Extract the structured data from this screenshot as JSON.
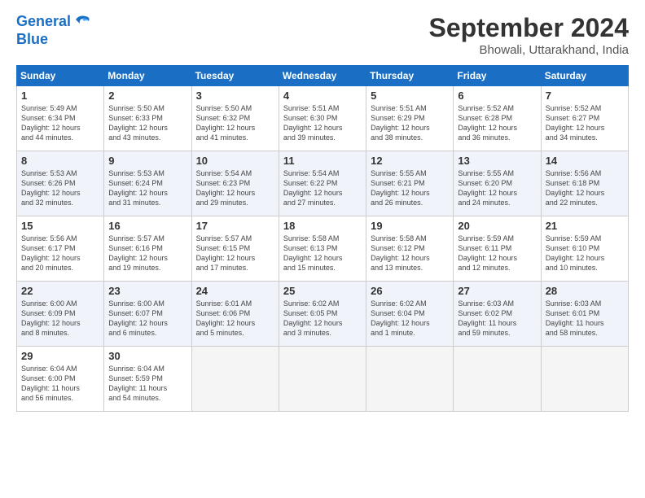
{
  "header": {
    "logo_line1": "General",
    "logo_line2": "Blue",
    "month": "September 2024",
    "location": "Bhowali, Uttarakhand, India"
  },
  "weekdays": [
    "Sunday",
    "Monday",
    "Tuesday",
    "Wednesday",
    "Thursday",
    "Friday",
    "Saturday"
  ],
  "weeks": [
    [
      {
        "day": "1",
        "info": "Sunrise: 5:49 AM\nSunset: 6:34 PM\nDaylight: 12 hours\nand 44 minutes."
      },
      {
        "day": "2",
        "info": "Sunrise: 5:50 AM\nSunset: 6:33 PM\nDaylight: 12 hours\nand 43 minutes."
      },
      {
        "day": "3",
        "info": "Sunrise: 5:50 AM\nSunset: 6:32 PM\nDaylight: 12 hours\nand 41 minutes."
      },
      {
        "day": "4",
        "info": "Sunrise: 5:51 AM\nSunset: 6:30 PM\nDaylight: 12 hours\nand 39 minutes."
      },
      {
        "day": "5",
        "info": "Sunrise: 5:51 AM\nSunset: 6:29 PM\nDaylight: 12 hours\nand 38 minutes."
      },
      {
        "day": "6",
        "info": "Sunrise: 5:52 AM\nSunset: 6:28 PM\nDaylight: 12 hours\nand 36 minutes."
      },
      {
        "day": "7",
        "info": "Sunrise: 5:52 AM\nSunset: 6:27 PM\nDaylight: 12 hours\nand 34 minutes."
      }
    ],
    [
      {
        "day": "8",
        "info": "Sunrise: 5:53 AM\nSunset: 6:26 PM\nDaylight: 12 hours\nand 32 minutes."
      },
      {
        "day": "9",
        "info": "Sunrise: 5:53 AM\nSunset: 6:24 PM\nDaylight: 12 hours\nand 31 minutes."
      },
      {
        "day": "10",
        "info": "Sunrise: 5:54 AM\nSunset: 6:23 PM\nDaylight: 12 hours\nand 29 minutes."
      },
      {
        "day": "11",
        "info": "Sunrise: 5:54 AM\nSunset: 6:22 PM\nDaylight: 12 hours\nand 27 minutes."
      },
      {
        "day": "12",
        "info": "Sunrise: 5:55 AM\nSunset: 6:21 PM\nDaylight: 12 hours\nand 26 minutes."
      },
      {
        "day": "13",
        "info": "Sunrise: 5:55 AM\nSunset: 6:20 PM\nDaylight: 12 hours\nand 24 minutes."
      },
      {
        "day": "14",
        "info": "Sunrise: 5:56 AM\nSunset: 6:18 PM\nDaylight: 12 hours\nand 22 minutes."
      }
    ],
    [
      {
        "day": "15",
        "info": "Sunrise: 5:56 AM\nSunset: 6:17 PM\nDaylight: 12 hours\nand 20 minutes."
      },
      {
        "day": "16",
        "info": "Sunrise: 5:57 AM\nSunset: 6:16 PM\nDaylight: 12 hours\nand 19 minutes."
      },
      {
        "day": "17",
        "info": "Sunrise: 5:57 AM\nSunset: 6:15 PM\nDaylight: 12 hours\nand 17 minutes."
      },
      {
        "day": "18",
        "info": "Sunrise: 5:58 AM\nSunset: 6:13 PM\nDaylight: 12 hours\nand 15 minutes."
      },
      {
        "day": "19",
        "info": "Sunrise: 5:58 AM\nSunset: 6:12 PM\nDaylight: 12 hours\nand 13 minutes."
      },
      {
        "day": "20",
        "info": "Sunrise: 5:59 AM\nSunset: 6:11 PM\nDaylight: 12 hours\nand 12 minutes."
      },
      {
        "day": "21",
        "info": "Sunrise: 5:59 AM\nSunset: 6:10 PM\nDaylight: 12 hours\nand 10 minutes."
      }
    ],
    [
      {
        "day": "22",
        "info": "Sunrise: 6:00 AM\nSunset: 6:09 PM\nDaylight: 12 hours\nand 8 minutes."
      },
      {
        "day": "23",
        "info": "Sunrise: 6:00 AM\nSunset: 6:07 PM\nDaylight: 12 hours\nand 6 minutes."
      },
      {
        "day": "24",
        "info": "Sunrise: 6:01 AM\nSunset: 6:06 PM\nDaylight: 12 hours\nand 5 minutes."
      },
      {
        "day": "25",
        "info": "Sunrise: 6:02 AM\nSunset: 6:05 PM\nDaylight: 12 hours\nand 3 minutes."
      },
      {
        "day": "26",
        "info": "Sunrise: 6:02 AM\nSunset: 6:04 PM\nDaylight: 12 hours\nand 1 minute."
      },
      {
        "day": "27",
        "info": "Sunrise: 6:03 AM\nSunset: 6:02 PM\nDaylight: 11 hours\nand 59 minutes."
      },
      {
        "day": "28",
        "info": "Sunrise: 6:03 AM\nSunset: 6:01 PM\nDaylight: 11 hours\nand 58 minutes."
      }
    ],
    [
      {
        "day": "29",
        "info": "Sunrise: 6:04 AM\nSunset: 6:00 PM\nDaylight: 11 hours\nand 56 minutes."
      },
      {
        "day": "30",
        "info": "Sunrise: 6:04 AM\nSunset: 5:59 PM\nDaylight: 11 hours\nand 54 minutes."
      },
      {
        "day": "",
        "info": ""
      },
      {
        "day": "",
        "info": ""
      },
      {
        "day": "",
        "info": ""
      },
      {
        "day": "",
        "info": ""
      },
      {
        "day": "",
        "info": ""
      }
    ]
  ]
}
